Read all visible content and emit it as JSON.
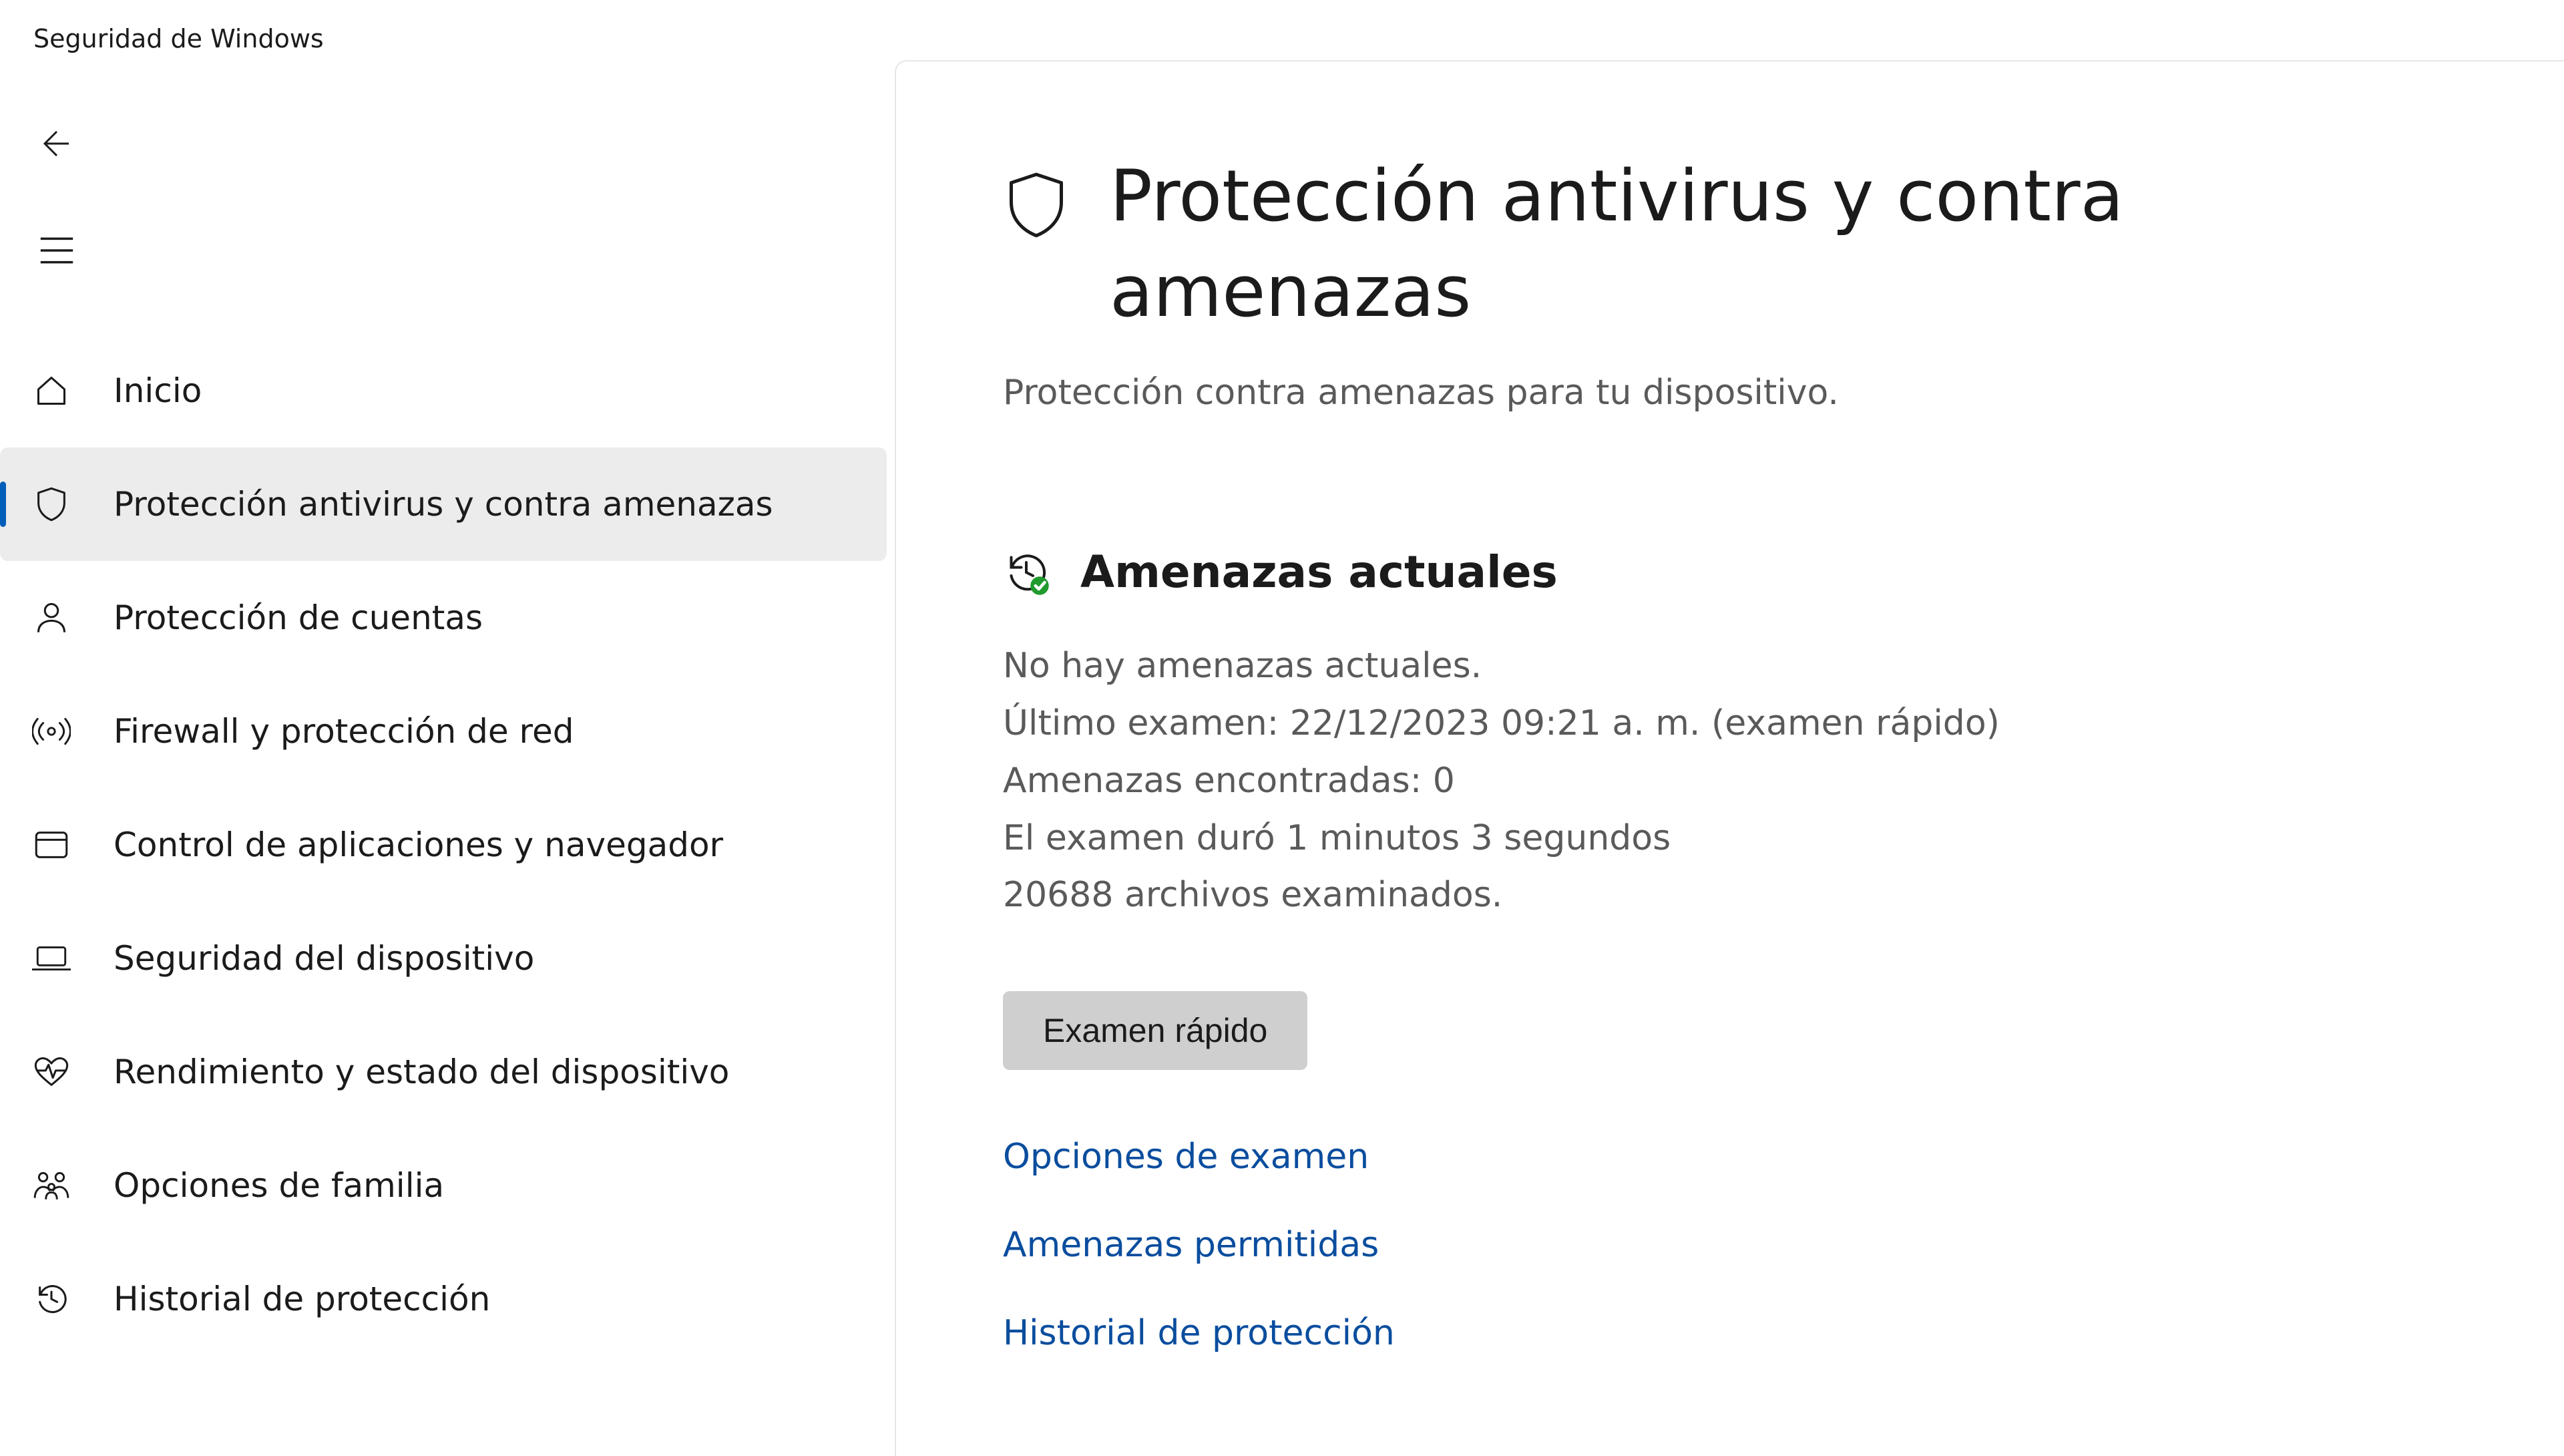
{
  "app_title": "Seguridad de Windows",
  "sidebar": {
    "items": [
      {
        "id": "home",
        "label": "Inicio"
      },
      {
        "id": "virus",
        "label": "Protección antivirus y contra amenazas"
      },
      {
        "id": "account",
        "label": "Protección de cuentas"
      },
      {
        "id": "firewall",
        "label": "Firewall y protección de red"
      },
      {
        "id": "appbrowser",
        "label": "Control de aplicaciones y navegador"
      },
      {
        "id": "device",
        "label": "Seguridad del dispositivo"
      },
      {
        "id": "health",
        "label": "Rendimiento y estado del dispositivo"
      },
      {
        "id": "family",
        "label": "Opciones de familia"
      },
      {
        "id": "history",
        "label": "Historial de protección"
      }
    ],
    "selected_id": "virus"
  },
  "main": {
    "title": "Protección antivirus y contra amenazas",
    "subtitle": "Protección contra amenazas para tu dispositivo.",
    "threats_section": {
      "title": "Amenazas actuales",
      "status_lines": [
        "No hay amenazas actuales.",
        "Último examen: 22/12/2023 09:21 a. m. (examen rápido)",
        "Amenazas encontradas: 0",
        "El examen duró 1 minutos 3 segundos",
        "20688 archivos examinados."
      ],
      "quick_scan_label": "Examen rápido",
      "links": [
        "Opciones de examen",
        "Amenazas permitidas",
        "Historial de protección"
      ]
    }
  }
}
